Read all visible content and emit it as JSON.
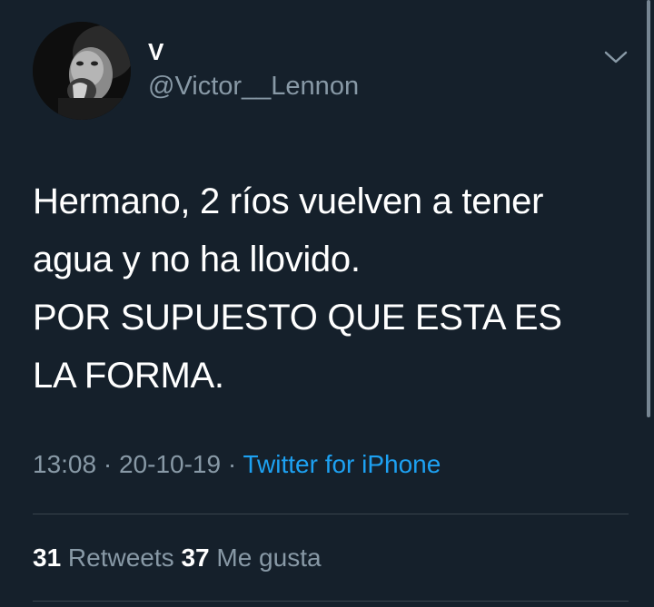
{
  "user": {
    "display_name": "V",
    "handle": "@Victor__Lennon",
    "avatar_icon": "profile-photo"
  },
  "tweet": {
    "lines": [
      "Hermano, 2 ríos vuelven a tener",
      "agua y no ha llovido.",
      "POR SUPUESTO QUE ESTA ES",
      "LA FORMA."
    ]
  },
  "meta": {
    "time": "13:08",
    "separator1": " · ",
    "date": "20-10-19",
    "separator2": " · ",
    "source": "Twitter for iPhone"
  },
  "stats": {
    "retweets_count": "31",
    "retweets_label": " Retweets ",
    "likes_count": "37",
    "likes_label": " Me gusta"
  },
  "colors": {
    "background": "#15202b",
    "text": "#ffffff",
    "secondary": "#8899a6",
    "link": "#1da1f2",
    "divider": "#38444d"
  },
  "icons": {
    "menu": "chevron-down-icon"
  }
}
